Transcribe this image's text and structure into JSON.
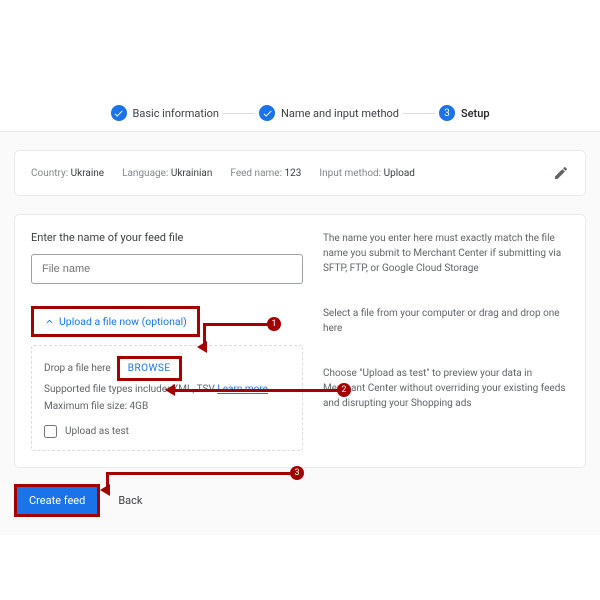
{
  "stepper": {
    "step1": "Basic information",
    "step2": "Name and input method",
    "step3_num": "3",
    "step3": "Setup"
  },
  "summary": {
    "countryLabel": "Country:",
    "countryVal": "Ukraine",
    "languageLabel": "Language:",
    "languageVal": "Ukrainian",
    "feedNameLabel": "Feed name:",
    "feedNameVal": "123",
    "inputMethodLabel": "Input method:",
    "inputMethodVal": "Upload"
  },
  "form": {
    "enterLabel": "Enter the name of your feed file",
    "fileNamePlaceholder": "File name",
    "uploadToggle": "Upload a file now (optional)",
    "dropHere": "Drop a file here",
    "browse": "BROWSE",
    "supported": "Supported file types include: XML, TSV ",
    "learnMore": "Learn more",
    "maxSize": "Maximum file size: 4GB",
    "uploadAsTest": "Upload as test"
  },
  "help": {
    "p1": "The name you enter here must exactly match the file name you submit to Merchant Center if submitting via SFTP, FTP, or Google Cloud Storage",
    "p2": "Select a file from your computer or drag and drop one here",
    "p3": "Choose \"Upload as test\" to preview your data in Merchant Center without overriding your existing feeds and disrupting your Shopping ads"
  },
  "buttons": {
    "create": "Create feed",
    "back": "Back"
  },
  "callouts": {
    "c1": "1",
    "c2": "2",
    "c3": "3"
  }
}
